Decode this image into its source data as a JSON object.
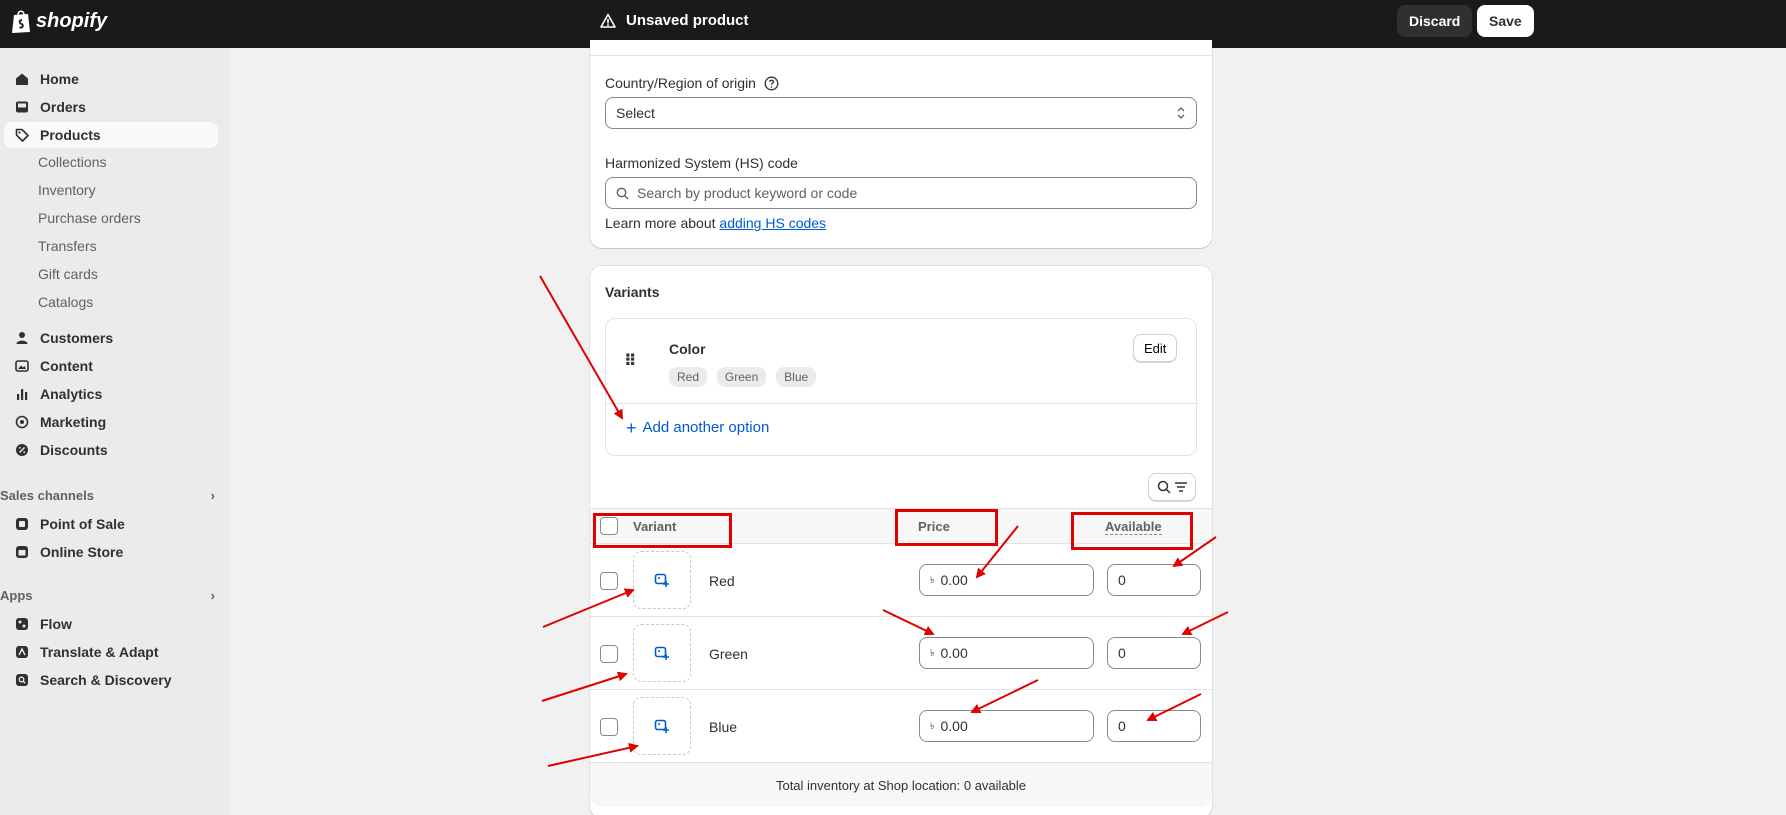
{
  "topbar": {
    "logo_text": "shopify",
    "status_text": "Unsaved product",
    "discard_label": "Discard",
    "save_label": "Save"
  },
  "sidebar": {
    "items": [
      {
        "label": "Home",
        "icon": "home-icon"
      },
      {
        "label": "Orders",
        "icon": "inbox-icon"
      },
      {
        "label": "Products",
        "icon": "tag-icon",
        "active": true
      },
      {
        "label": "Customers",
        "icon": "person-icon"
      },
      {
        "label": "Content",
        "icon": "image-icon"
      },
      {
        "label": "Analytics",
        "icon": "bar-chart-icon"
      },
      {
        "label": "Marketing",
        "icon": "target-icon"
      },
      {
        "label": "Discounts",
        "icon": "discount-icon"
      }
    ],
    "product_subitems": [
      "Collections",
      "Inventory",
      "Purchase orders",
      "Transfers",
      "Gift cards",
      "Catalogs"
    ],
    "sales_channels": {
      "title": "Sales channels",
      "items": [
        {
          "label": "Point of Sale",
          "icon": "pos-icon"
        },
        {
          "label": "Online Store",
          "icon": "store-icon"
        }
      ]
    },
    "apps": {
      "title": "Apps",
      "items": [
        {
          "label": "Flow",
          "icon": "flow-icon"
        },
        {
          "label": "Translate & Adapt",
          "icon": "translate-icon"
        },
        {
          "label": "Search & Discovery",
          "icon": "search-discovery-icon"
        }
      ]
    }
  },
  "shipping": {
    "country_label": "Country/Region of origin",
    "country_value": "Select",
    "hs_label": "Harmonized System (HS) code",
    "hs_placeholder": "Search by product keyword or code",
    "learn_more_prefix": "Learn more about",
    "learn_more_link": "adding HS codes"
  },
  "variants": {
    "title": "Variants",
    "option_name": "Color",
    "option_values": [
      "Red",
      "Green",
      "Blue"
    ],
    "edit_label": "Edit",
    "add_option_label": "Add another option",
    "columns": {
      "variant": "Variant",
      "price": "Price",
      "available": "Available"
    },
    "currency_symbol": "৳",
    "rows": [
      {
        "name": "Red",
        "price": "0.00",
        "available": "0"
      },
      {
        "name": "Green",
        "price": "0.00",
        "available": "0"
      },
      {
        "name": "Blue",
        "price": "0.00",
        "available": "0"
      }
    ],
    "total_text": "Total inventory at Shop location: 0 available"
  },
  "colors": {
    "topbar_bg": "#1a1a1a",
    "link": "#005bd3",
    "annotation_red": "#e00000"
  }
}
